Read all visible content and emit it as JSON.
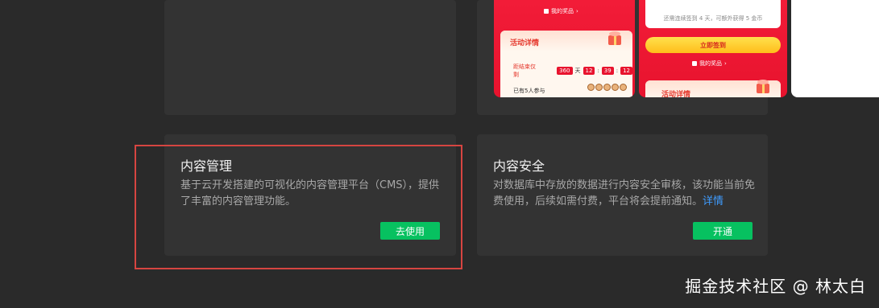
{
  "promo": {
    "my_prize_label": "我的奖品",
    "detail_title": "活动详情",
    "countdown_label": "距结束仅剩",
    "countdown_days": "360",
    "days_unit": "天",
    "countdown_h": "12",
    "countdown_m": "39",
    "countdown_s": "12",
    "joined_text": "已有5人参与",
    "signin_hint": "还需连续签到 4 天，可额外获得 5 金币",
    "signin_button": "立即签到",
    "my_prize_label_b": "我的奖品",
    "detail_title_b": "活动详情"
  },
  "cms": {
    "title": "内容管理",
    "description": "基于云开发搭建的可视化的内容管理平台（CMS），提供了丰富的内容管理功能。",
    "button": "去使用"
  },
  "security": {
    "title": "内容安全",
    "description": "对数据库中存放的数据进行内容安全审核，该功能当前免费使用，后续如需付费，平台将会提前通知。",
    "link": "详情",
    "button": "开通"
  },
  "watermark": "掘金技术社区 @ 林太白",
  "colors": {
    "background": "#2a2a2a",
    "card": "#333333",
    "primary_button": "#07c160",
    "link": "#3f9cff",
    "highlight_border": "#d64541",
    "promo_red": "#e8132e"
  }
}
